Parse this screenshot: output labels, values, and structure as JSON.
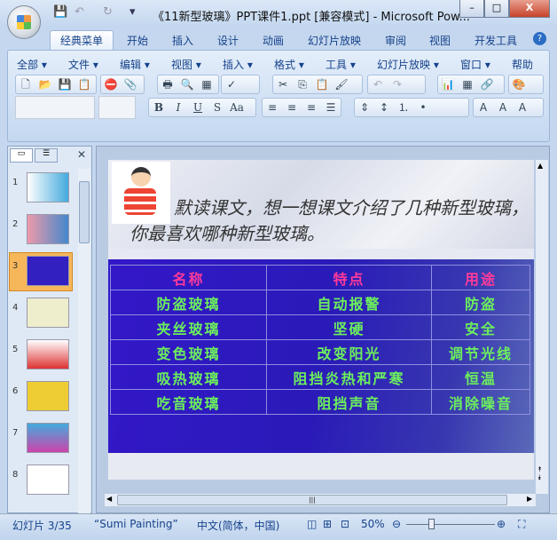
{
  "window": {
    "title": "《11新型玻璃》PPT课件1.ppt [兼容模式] - Microsoft Pow...",
    "minimize": "–",
    "maximize": "□",
    "close": "X"
  },
  "qat": {
    "save": "💾",
    "undo": "↶",
    "redo": "↻",
    "customize": "▾"
  },
  "tabs": [
    "经典菜单",
    "开始",
    "插入",
    "设计",
    "动画",
    "幻灯片放映",
    "审阅",
    "视图",
    "开发工具"
  ],
  "help": "?",
  "menus": [
    "全部",
    "文件",
    "编辑",
    "视图",
    "插入",
    "格式",
    "工具",
    "幻灯片放映",
    "窗口",
    "帮助"
  ],
  "format_buttons": [
    "B",
    "I",
    "U",
    "S",
    "Aa"
  ],
  "thumbnails": [
    "1",
    "2",
    "3",
    "4",
    "5",
    "6",
    "7",
    "8"
  ],
  "slide": {
    "question": "默读课文，想一想课文介绍了几种新型玻璃，你最喜欢哪种新型玻璃。",
    "headers": [
      "名称",
      "特点",
      "用途"
    ],
    "rows": [
      [
        "防盗玻璃",
        "自动报警",
        "防盗"
      ],
      [
        "夹丝玻璃",
        "坚硬",
        "安全"
      ],
      [
        "变色玻璃",
        "改变阳光",
        "调节光线"
      ],
      [
        "吸热玻璃",
        "阻挡炎热和严寒",
        "恒温"
      ],
      [
        "吃音玻璃",
        "阻挡声音",
        "消除噪音"
      ]
    ]
  },
  "status": {
    "slide": "幻灯片 3/35",
    "theme": "“Sumi Painting”",
    "language": "中文(简体，中国)",
    "zoom": "50%",
    "zoom_fraction": 0.5
  }
}
